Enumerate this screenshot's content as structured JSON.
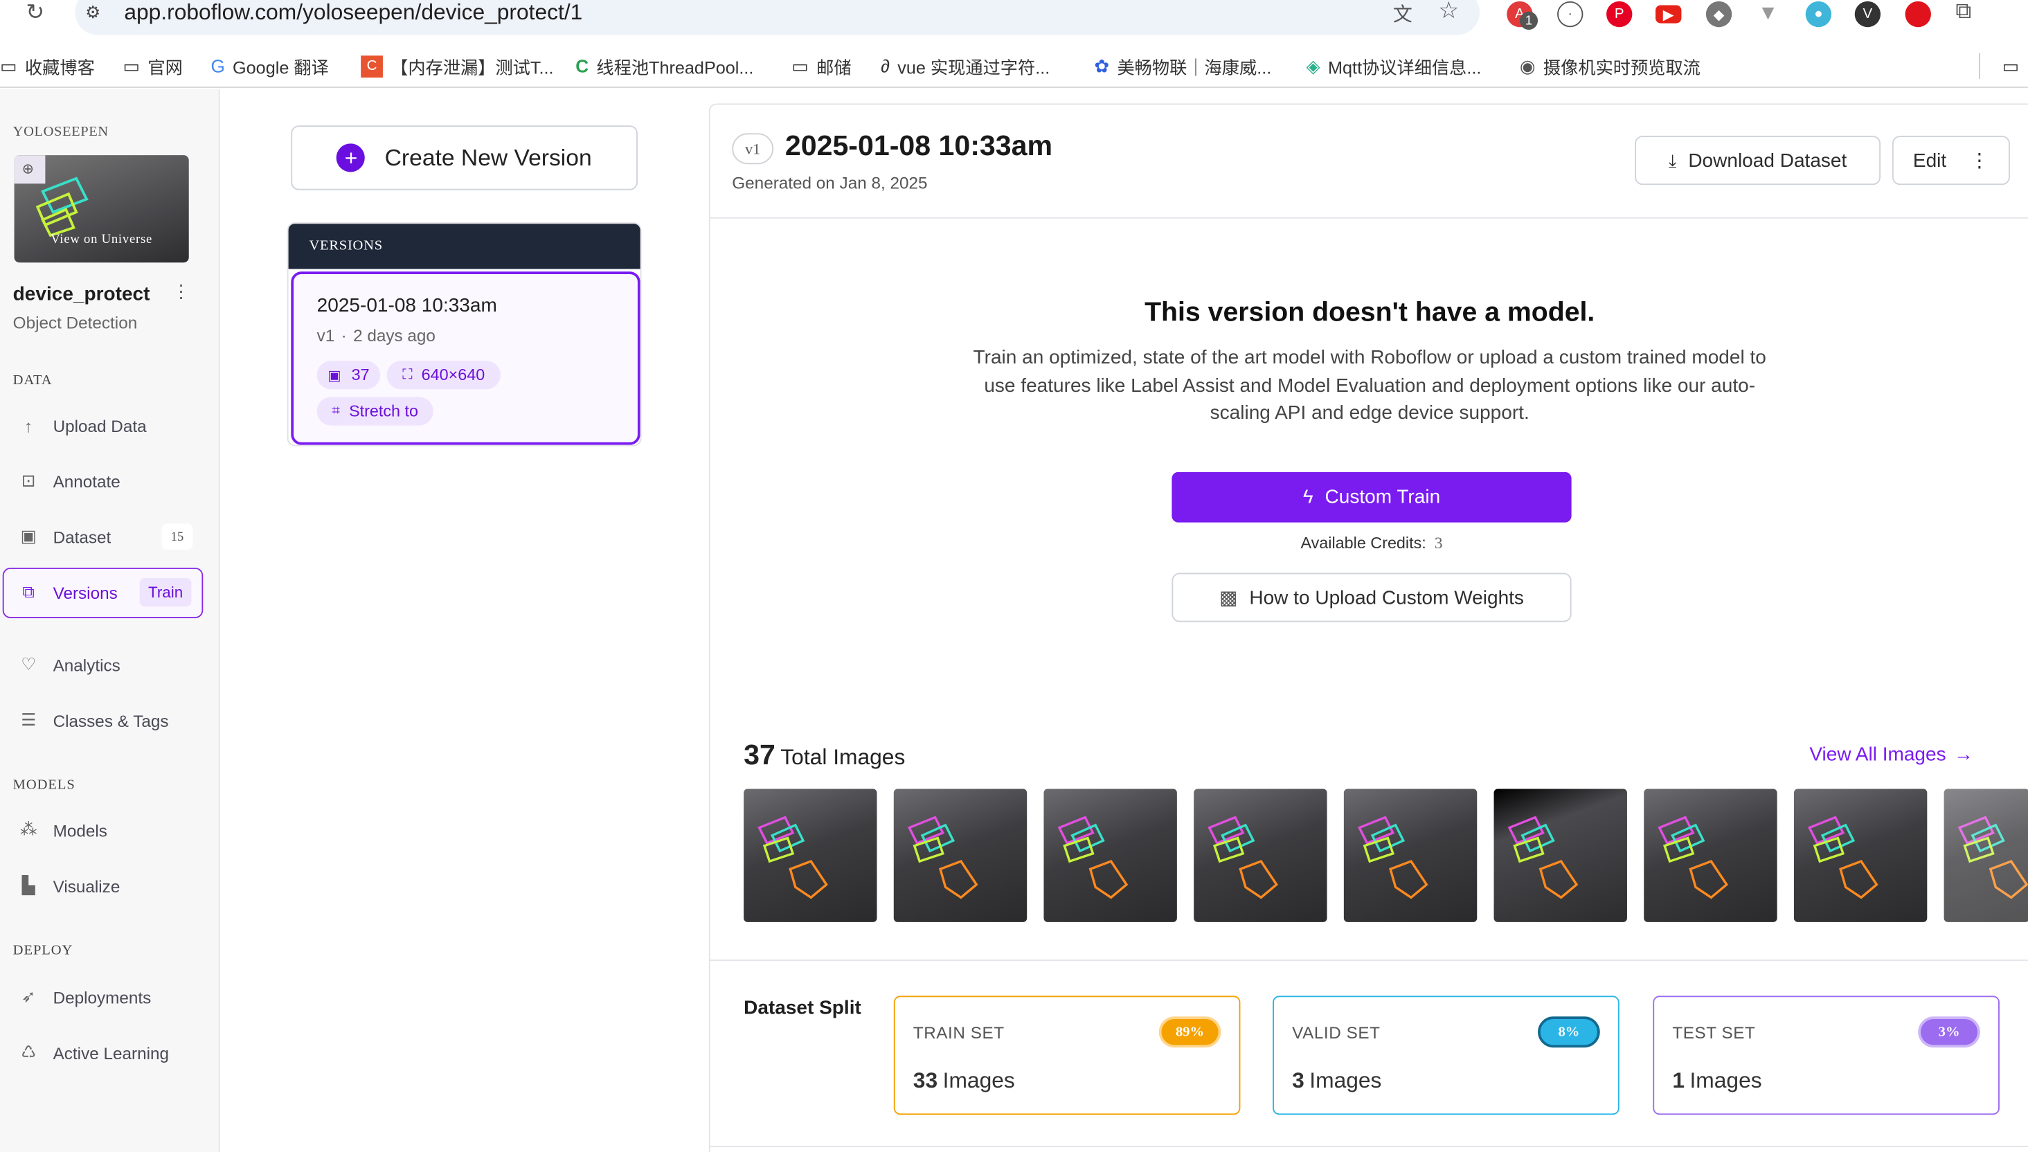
{
  "browser": {
    "url": "app.roboflow.com/yoloseepen/device_protect/1",
    "bookmarks": [
      "收藏博客",
      "官网",
      "Google 翻译",
      "【内存泄漏】测试T...",
      "线程池ThreadPool...",
      "邮储",
      "vue 实现通过字符...",
      "美畅物联｜海康威...",
      "Mqtt协议详细信息...",
      "摄像机实时预览取流"
    ],
    "ext_badge": "1"
  },
  "sidebar": {
    "workspace": "YOLOSEEPEN",
    "view_universe": "View on Universe",
    "project_name": "device_protect",
    "project_type": "Object Detection",
    "sections": {
      "data": "DATA",
      "models": "MODELS",
      "deploy": "DEPLOY"
    },
    "data_items": [
      {
        "label": "Upload Data",
        "icon": "upload-icon"
      },
      {
        "label": "Annotate",
        "icon": "annotate-icon"
      },
      {
        "label": "Dataset",
        "icon": "image-icon",
        "badge": "15"
      },
      {
        "label": "Versions",
        "icon": "versions-icon",
        "badge": "Train"
      }
    ],
    "other_items": [
      {
        "label": "Analytics",
        "icon": "heart-pulse-icon"
      },
      {
        "label": "Classes & Tags",
        "icon": "list-icon"
      }
    ],
    "model_items": [
      {
        "label": "Models",
        "icon": "network-icon"
      },
      {
        "label": "Visualize",
        "icon": "chart-icon"
      }
    ],
    "deploy_items": [
      {
        "label": "Deployments",
        "icon": "rocket-icon"
      },
      {
        "label": "Active Learning",
        "icon": "recycle-icon"
      }
    ]
  },
  "versions_panel": {
    "create_button": "Create New Version",
    "header": "VERSIONS",
    "selected": {
      "title": "2025-01-08 10:33am",
      "version": "v1",
      "age": "2 days ago",
      "images": "37",
      "size": "640×640",
      "resize": "Stretch to"
    }
  },
  "main": {
    "version_tag": "v1",
    "title": "2025-01-08 10:33am",
    "generated": "Generated on Jan 8, 2025",
    "download_button": "Download Dataset",
    "edit_button": "Edit",
    "no_model_title": "This version doesn't have a model.",
    "no_model_desc": "Train an optimized, state of the art model with Roboflow or upload a custom trained model to use features like Label Assist and Model Evaluation and deployment options like our auto-scaling API and edge device support.",
    "custom_train_button": "Custom Train",
    "credits_label": "Available Credits:",
    "credits_value": "3",
    "upload_weights_button": "How to Upload Custom Weights",
    "total_images_count": "37",
    "total_images_label": "Total Images",
    "view_all": "View All Images",
    "split_title": "Dataset Split",
    "split": [
      {
        "label": "TRAIN SET",
        "pct": "89%",
        "count": "33",
        "unit": "Images",
        "color": "#f5a100"
      },
      {
        "label": "VALID SET",
        "pct": "8%",
        "count": "3",
        "unit": "Images",
        "color": "#2bb5e6"
      },
      {
        "label": "TEST SET",
        "pct": "3%",
        "count": "1",
        "unit": "Images",
        "color": "#9b6cf0"
      }
    ]
  },
  "colors": {
    "accent": "#7a1bf0",
    "brand_purple": "#6a0fe0"
  }
}
